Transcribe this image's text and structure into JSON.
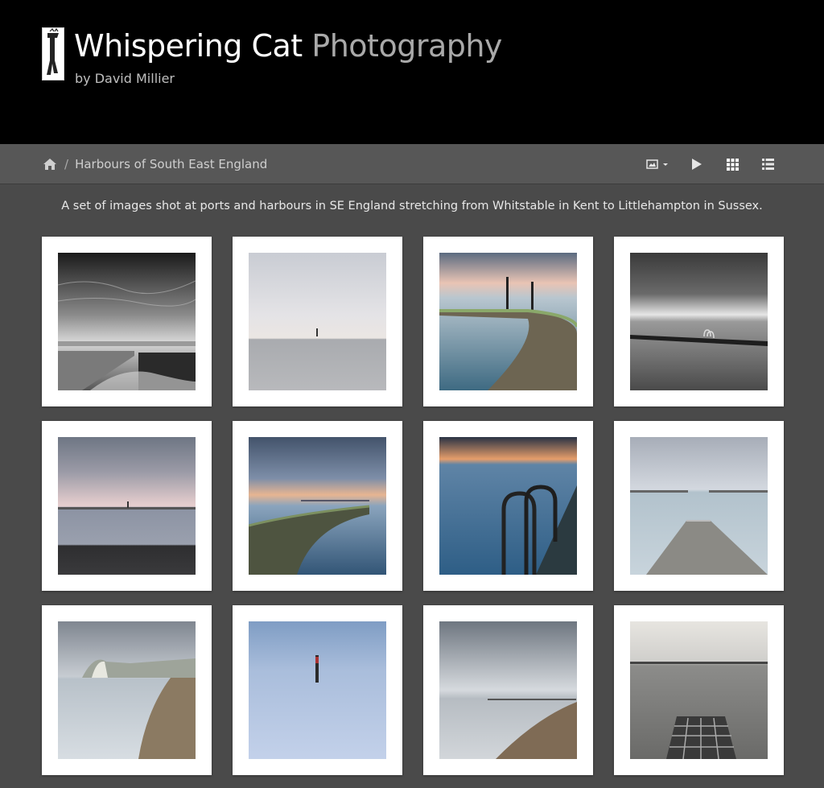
{
  "site": {
    "title_main": "Whispering Cat",
    "title_muted": "Photography",
    "byline": "by David Millier"
  },
  "breadcrumb": {
    "home_icon": "home-icon",
    "separator": "/",
    "current": "Harbours of South East England"
  },
  "toolbar": {
    "icons": [
      "image-dropdown-icon",
      "play-icon",
      "grid-icon",
      "list-icon"
    ]
  },
  "album": {
    "description": "A set of images shot at ports and harbours in SE England stretching from Whitstable in Kent to Littlehampton in Sussex."
  },
  "colors": {
    "header_bg": "#000000",
    "toolbar_bg": "#575757",
    "page_bg": "#4a4a4a",
    "tile_bg": "#ffffff"
  },
  "gallery": {
    "thumbnails": [
      {
        "subject": "bw-harbour-wall-dramatic-sky"
      },
      {
        "subject": "figure-standing-in-calm-sea"
      },
      {
        "subject": "tidal-pool-wall-with-posts"
      },
      {
        "subject": "bw-tidal-pool-ladder"
      },
      {
        "subject": "pier-horizon-pink-sky"
      },
      {
        "subject": "curved-breakwater-sunset"
      },
      {
        "subject": "pool-ladder-at-dusk"
      },
      {
        "subject": "jetty-into-calm-sea"
      },
      {
        "subject": "white-cliffs-beach"
      },
      {
        "subject": "marker-post-misty-sea"
      },
      {
        "subject": "long-exposure-beach"
      },
      {
        "subject": "bw-shingle-beach-grate"
      }
    ]
  }
}
